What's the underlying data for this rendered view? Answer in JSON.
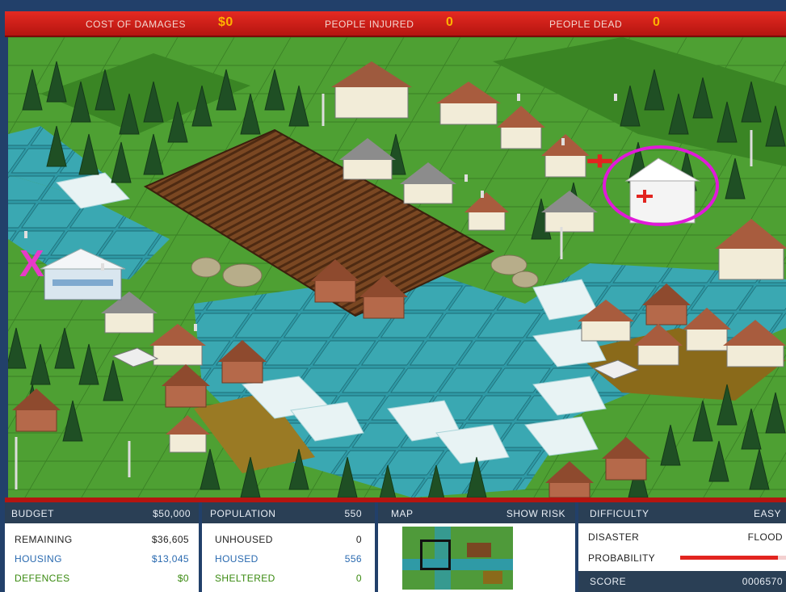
{
  "topbar": {
    "cost_label": "COST OF DAMAGES",
    "cost_value": "$0",
    "injured_label": "PEOPLE INJURED",
    "injured_value": "0",
    "dead_label": "PEOPLE DEAD",
    "dead_value": "0"
  },
  "map_markers": {
    "x_marker": "X"
  },
  "budget_panel": {
    "title": "BUDGET",
    "total": "$50,000",
    "rows": [
      {
        "label": "REMAINING",
        "value": "$36,605"
      },
      {
        "label": "HOUSING",
        "value": "$13,045"
      },
      {
        "label": "DEFENCES",
        "value": "$0"
      }
    ]
  },
  "population_panel": {
    "title": "POPULATION",
    "total": "550",
    "rows": [
      {
        "label": "UNHOUSED",
        "value": "0"
      },
      {
        "label": "HOUSED",
        "value": "556"
      },
      {
        "label": "SHELTERED",
        "value": "0"
      }
    ]
  },
  "map_panel": {
    "title": "MAP",
    "toggle": "SHOW RISK"
  },
  "difficulty_panel": {
    "title": "DIFFICULTY",
    "level": "EASY",
    "disaster_label": "DISASTER",
    "disaster_value": "FLOOD",
    "probability_label": "PROBABILITY",
    "probability_level": 0.92,
    "score_label": "SCORE",
    "score_value": "0006570"
  },
  "colors": {
    "topbar_red": "#d4201a",
    "grass": "#4fa033",
    "water": "#2e9ba5",
    "field": "#6a3d1e",
    "highlight_magenta": "#e01ad8",
    "panel_header": "#2a3f55"
  }
}
